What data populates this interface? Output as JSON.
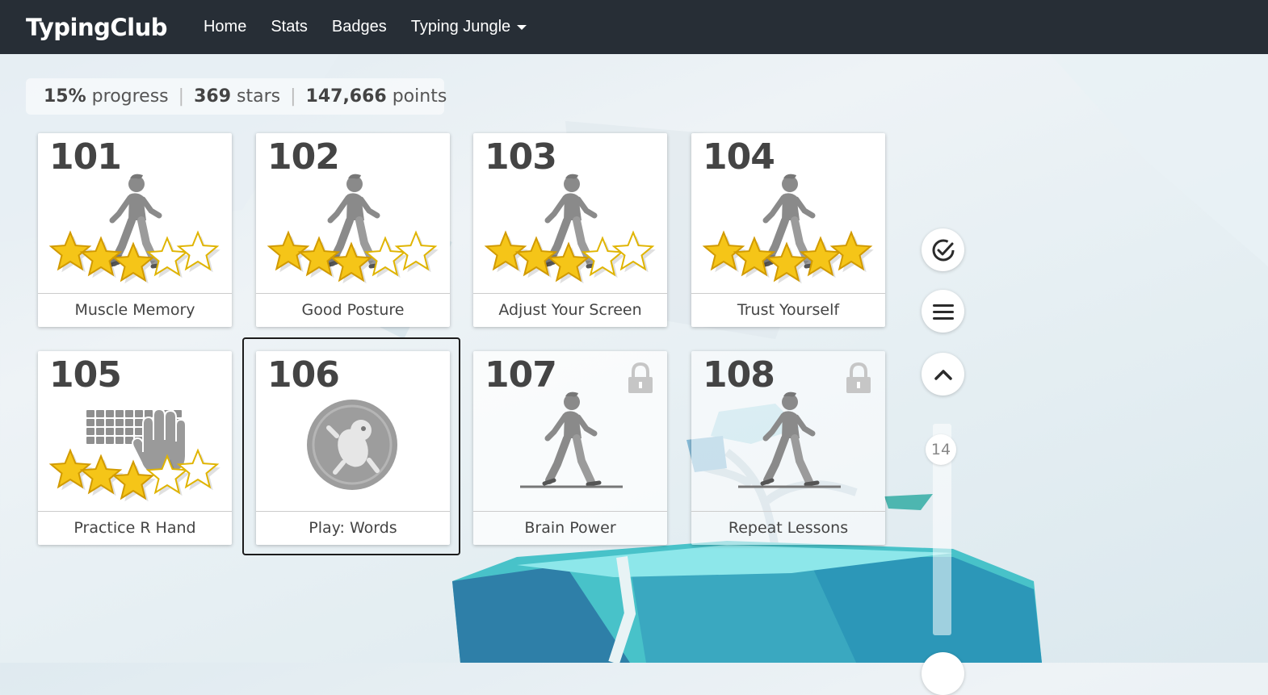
{
  "navbar": {
    "brand": "TypingClub",
    "links": [
      "Home",
      "Stats",
      "Badges",
      "Typing Jungle"
    ]
  },
  "stats": {
    "progress_value": "15%",
    "progress_label": "progress",
    "stars_value": "369",
    "stars_label": "stars",
    "points_value": "147,666",
    "points_label": "points",
    "separator": "|"
  },
  "lessons": [
    {
      "number": "101",
      "title": "Muscle Memory",
      "stars": 3,
      "icon": "walking-person-icon",
      "locked": false
    },
    {
      "number": "102",
      "title": "Good Posture",
      "stars": 3,
      "icon": "walking-person-icon",
      "locked": false
    },
    {
      "number": "103",
      "title": "Adjust Your Screen",
      "stars": 3,
      "icon": "walking-person-icon",
      "locked": false
    },
    {
      "number": "104",
      "title": "Trust Yourself",
      "stars": 5,
      "icon": "walking-person-icon",
      "locked": false
    },
    {
      "number": "105",
      "title": "Practice R Hand",
      "stars": 3,
      "icon": "keyboard-hand-icon",
      "locked": false
    },
    {
      "number": "106",
      "title": "Play: Words",
      "stars": 0,
      "icon": "game-coin-icon",
      "locked": false,
      "selected": true
    },
    {
      "number": "107",
      "title": "Brain Power",
      "stars": 0,
      "icon": "walking-person-icon",
      "locked": true
    },
    {
      "number": "108",
      "title": "Repeat Lessons",
      "stars": 0,
      "icon": "walking-person-icon",
      "locked": true
    }
  ],
  "sidebar": {
    "buttons": [
      "check-circle-icon",
      "menu-icon",
      "chevron-up-icon"
    ],
    "level": "14"
  },
  "colors": {
    "navbar": "#272e36",
    "star_gold": "#f5c518",
    "icon_gray": "#8a8a8a"
  }
}
